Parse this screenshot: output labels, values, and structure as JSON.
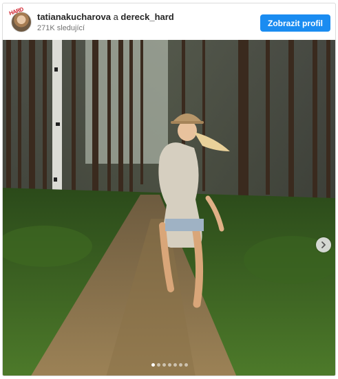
{
  "post": {
    "author": "tatianakucharova",
    "connector": "a",
    "coauthor": "dereck_hard",
    "followers": "271K sledující",
    "brand_mark": "HARD"
  },
  "actions": {
    "view_profile": "Zobrazit profil"
  },
  "carousel": {
    "slides": 7,
    "active": 1,
    "next_icon": "chevron-right-icon"
  },
  "colors": {
    "button": "#1a8cf1",
    "text": "#262626",
    "muted": "#737373"
  }
}
